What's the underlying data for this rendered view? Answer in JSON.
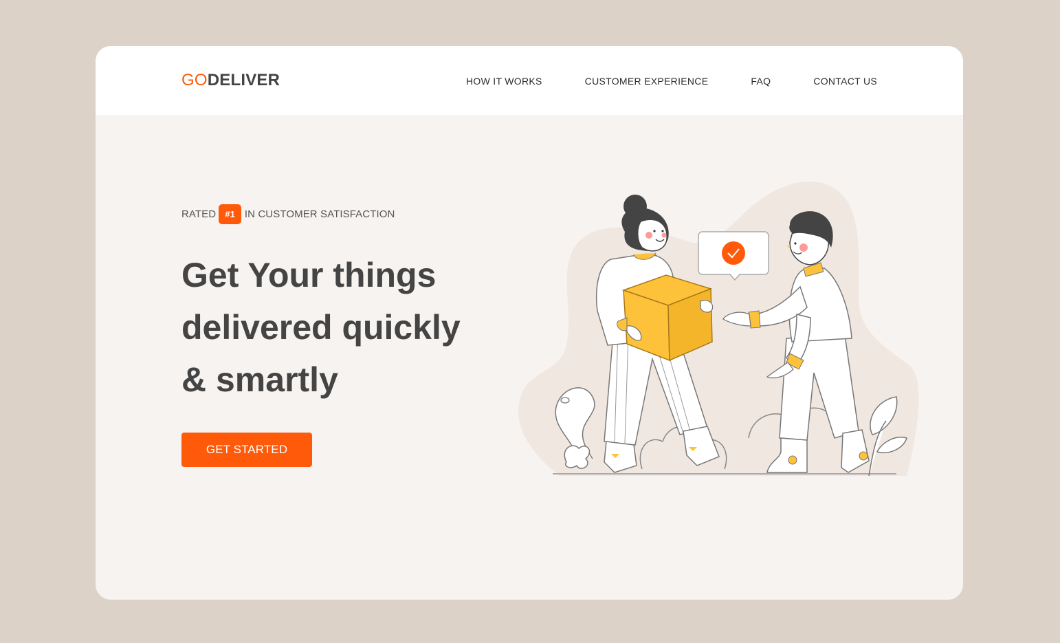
{
  "header": {
    "logo": {
      "part1": "GO",
      "part2": "DELIVER"
    },
    "nav": [
      {
        "label": "HOW IT WORKS"
      },
      {
        "label": "CUSTOMER EXPERIENCE"
      },
      {
        "label": "FAQ"
      },
      {
        "label": "CONTACT US"
      }
    ]
  },
  "hero": {
    "rated": {
      "prefix": "RATED",
      "badge": "#1",
      "suffix": "IN CUSTOMER SATISFACTION"
    },
    "headline": [
      "Get Your things",
      "delivered quickly",
      "& smartly"
    ],
    "cta_label": "GET STARTED"
  },
  "icons": {
    "illustration": "delivery-handoff-illustration",
    "speech_bubble": "check-circle-icon"
  },
  "colors": {
    "accent": "#ff5a0a",
    "page_bg": "#ddd2c8",
    "card_bg": "#f6f3f0",
    "header_bg": "#ffffff",
    "text_dark": "#444444",
    "box_yellow": "#fdc23a"
  }
}
